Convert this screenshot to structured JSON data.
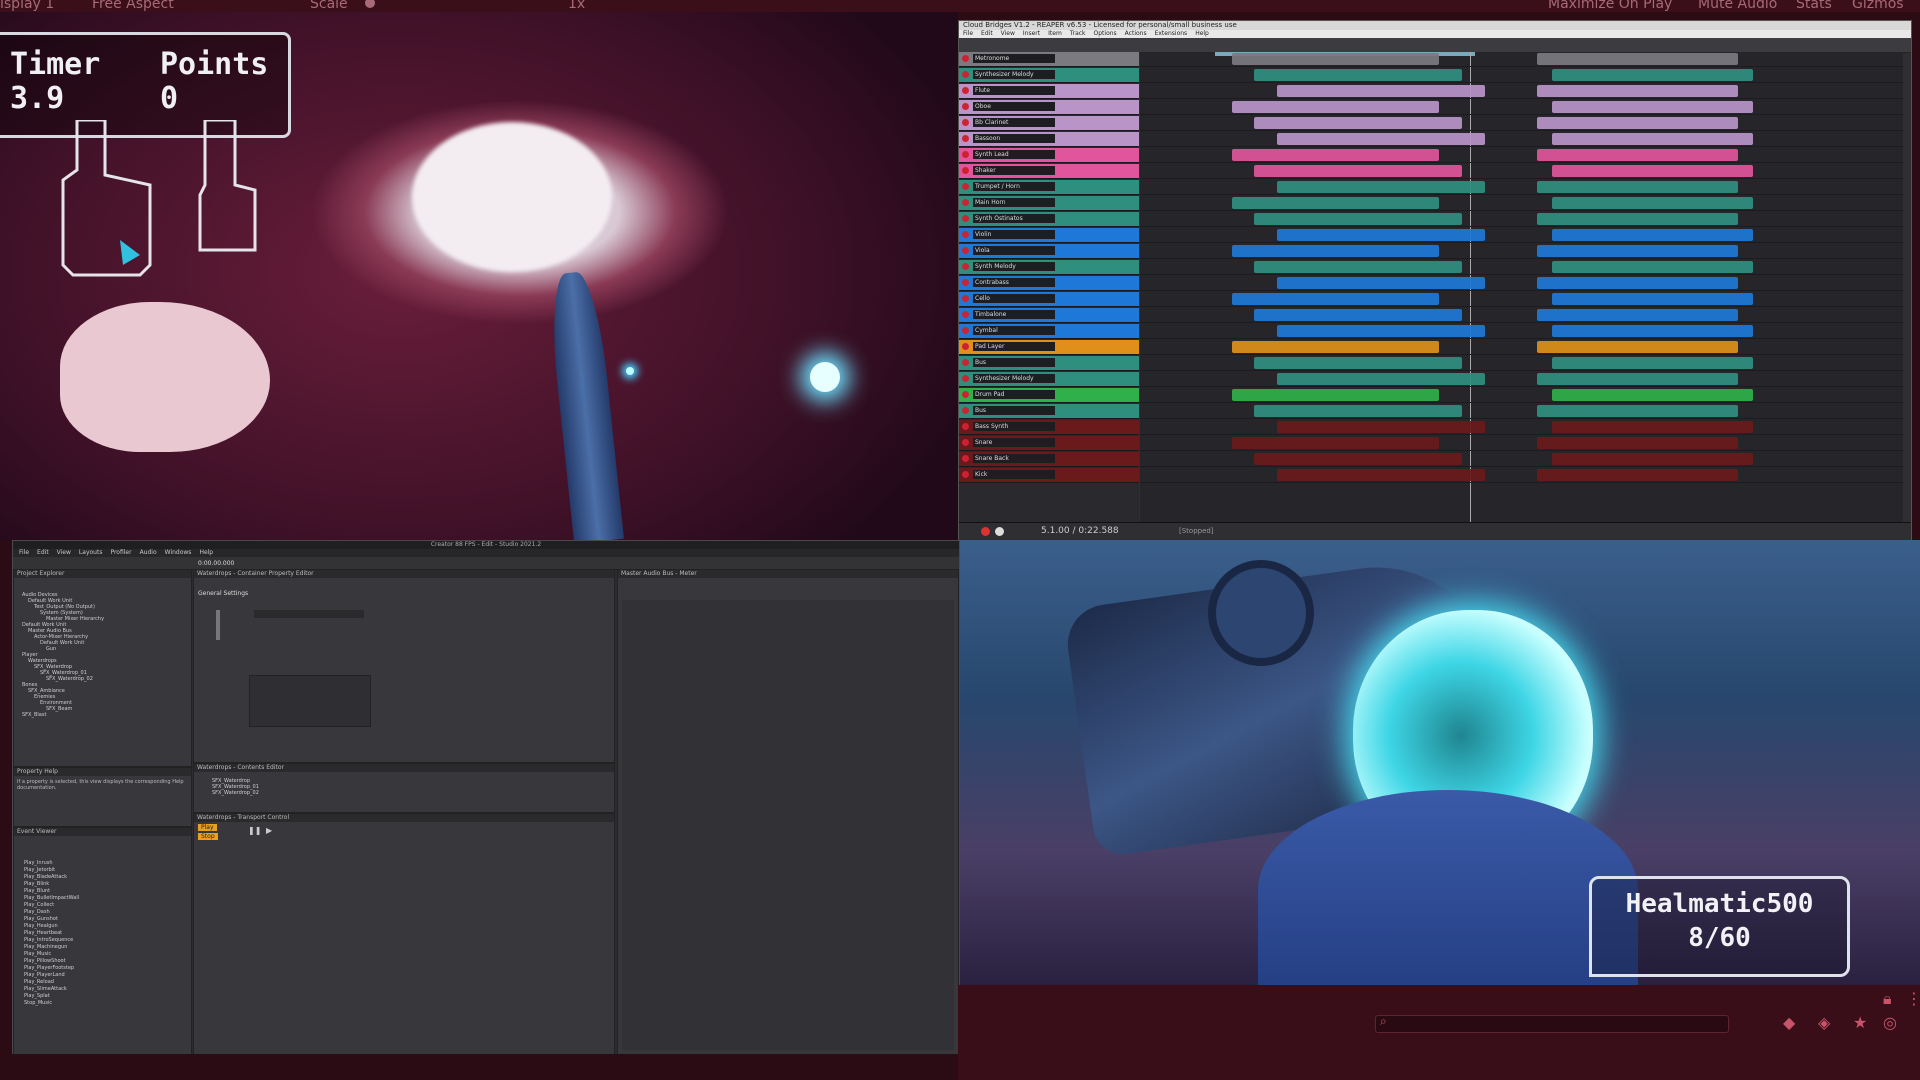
{
  "topbar": {
    "display": "isplay 1",
    "aspect": "Free Aspect",
    "scale_label": "Scale",
    "scale_value": "1x",
    "maximize": "Maximize On Play",
    "mute": "Mute Audio",
    "stats": "Stats",
    "gizmos": "Gizmos"
  },
  "hud": {
    "timer_label": "Timer",
    "timer_value": "3.9",
    "points_label": "Points",
    "points_value": "0"
  },
  "weapon": {
    "name": "Healmatic500",
    "ammo": "8/60"
  },
  "reaper": {
    "title": "Cloud Bridges V1.2 - REAPER v6.53 - Licensed for personal/small business use",
    "menu": [
      "File",
      "Edit",
      "View",
      "Insert",
      "Item",
      "Track",
      "Options",
      "Actions",
      "Extensions",
      "Help"
    ],
    "time": "5.1.00 / 0:22.588",
    "status": "[Stopped]",
    "tracks": [
      {
        "name": "Metronome",
        "color": "#7a7a80"
      },
      {
        "name": "Synthesizer Melody",
        "color": "#2f8f7f"
      },
      {
        "name": "Flute",
        "color": "#b994c9"
      },
      {
        "name": "Oboe",
        "color": "#b994c9"
      },
      {
        "name": "Bb Clarinet",
        "color": "#b994c9"
      },
      {
        "name": "Bassoon",
        "color": "#b994c9"
      },
      {
        "name": "Synth Lead",
        "color": "#e0559b"
      },
      {
        "name": "Shaker",
        "color": "#e0559b"
      },
      {
        "name": "Trumpet / Horn",
        "color": "#2f8f7f"
      },
      {
        "name": "Main Horn",
        "color": "#2f8f7f"
      },
      {
        "name": "Synth Ostinatos",
        "color": "#2f8f7f"
      },
      {
        "name": "Violin",
        "color": "#1e78d8"
      },
      {
        "name": "Viola",
        "color": "#1e78d8"
      },
      {
        "name": "Synth Melody",
        "color": "#2f8f7f"
      },
      {
        "name": "Contrabass",
        "color": "#1e78d8"
      },
      {
        "name": "Cello",
        "color": "#1e78d8"
      },
      {
        "name": "Timbalone",
        "color": "#1e78d8"
      },
      {
        "name": "Cymbal",
        "color": "#1e78d8"
      },
      {
        "name": "Pad Layer",
        "color": "#e0901a"
      },
      {
        "name": "Bus",
        "color": "#2f8f7f"
      },
      {
        "name": "Synthesizer Melody",
        "color": "#2f8f7f"
      },
      {
        "name": "Drum Pad",
        "color": "#2fb04a"
      },
      {
        "name": "Bus",
        "color": "#2f8f7f"
      },
      {
        "name": "Bass Synth",
        "color": "#6a1a1a"
      },
      {
        "name": "Snare",
        "color": "#6a1a1a"
      },
      {
        "name": "Snare Back",
        "color": "#6a1a1a"
      },
      {
        "name": "Kick",
        "color": "#6a1a1a"
      }
    ]
  },
  "fmod": {
    "title": "Creator 88 FPS - Edit - Studio 2021.2",
    "menu": [
      "File",
      "Edit",
      "View",
      "Layouts",
      "Profiler",
      "Audio",
      "Windows",
      "Help"
    ],
    "timecode": "0:00.00.000",
    "project_explorer": "Project Explorer",
    "tree": [
      "Audio Devices",
      "Default Work Unit",
      "Test_Output (No Output)",
      "System (System)",
      "Master Mixer Hierarchy",
      "Default Work Unit",
      "Master Audio Bus",
      "Actor-Mixer Hierarchy",
      "Default Work Unit",
      "Gun",
      "Player",
      "Waterdrops",
      "SFX_Waterdrop",
      "SFX_Waterdrop_01",
      "SFX_Waterdrop_02",
      "Bones",
      "SFX_Ambiance",
      "Enemies",
      "Environment",
      "SFX_Beam",
      "SFX_Blast"
    ],
    "property_help": "Property Help",
    "help_text": "If a property is selected, this view displays the corresponding Help documentation.",
    "event_viewer": "Event Viewer",
    "events": [
      "Play_Inrush",
      "Play_Jetorbit",
      "Play_BladeAttack",
      "Play_Blink",
      "Play_Blunt",
      "Play_BulletImpactWall",
      "Play_Collect",
      "Play_Dash",
      "Play_Gunshot",
      "Play_Healgun",
      "Play_Heartbeat",
      "Play_IntroSequence",
      "Play_Machinegun",
      "Play_Music",
      "Play_PillowShoot",
      "Play_PlayerFootstep",
      "Play_PlayerLand",
      "Play_Reload",
      "Play_SlimeAttack",
      "Play_Splat",
      "Stop_Music"
    ],
    "editor_tab": "Waterdrops - Container Property Editor",
    "general_settings": "General Settings",
    "contents_editor": "Waterdrops - Contents Editor",
    "contents": [
      "SFX_Waterdrop",
      "SFX_Waterdrop_01",
      "SFX_Waterdrop_02"
    ],
    "transport": "Waterdrops - Transport Control",
    "play": "Play",
    "stop": "Stop",
    "master_bus": "Master Audio Bus - Meter"
  }
}
